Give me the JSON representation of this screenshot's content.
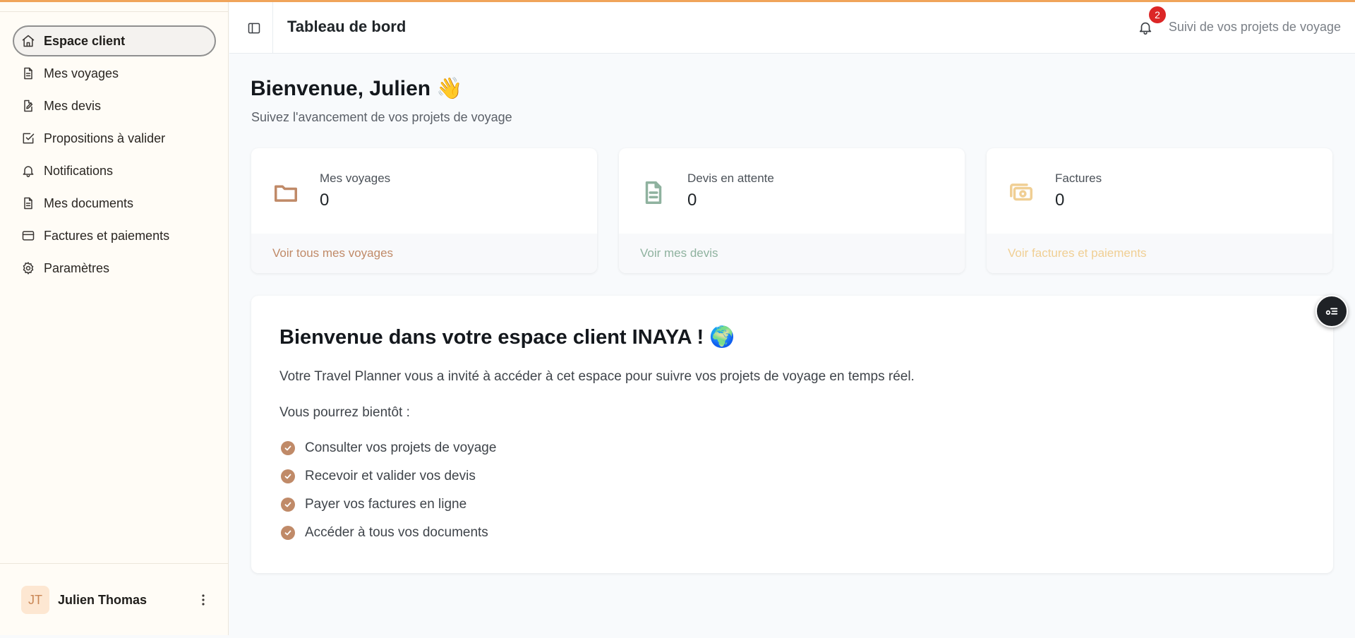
{
  "sidebar": {
    "items": [
      {
        "label": "Espace client",
        "icon": "home-icon",
        "active": true
      },
      {
        "label": "Mes voyages",
        "icon": "document-icon"
      },
      {
        "label": "Mes devis",
        "icon": "edit-document-icon"
      },
      {
        "label": "Propositions à valider",
        "icon": "check-square-icon"
      },
      {
        "label": "Notifications",
        "icon": "bell-icon"
      },
      {
        "label": "Mes documents",
        "icon": "document-icon"
      },
      {
        "label": "Factures et paiements",
        "icon": "credit-card-icon"
      },
      {
        "label": "Paramètres",
        "icon": "gear-icon"
      }
    ],
    "user": {
      "initials": "JT",
      "name": "Julien Thomas"
    }
  },
  "header": {
    "title": "Tableau de bord",
    "notification_count": "2",
    "subtitle": "Suivi de vos projets de voyage"
  },
  "main": {
    "welcome_title": "Bienvenue, Julien 👋",
    "welcome_sub": "Suivez l'avancement de vos projets de voyage",
    "stats": [
      {
        "label": "Mes voyages",
        "value": "0",
        "link": "Voir tous mes voyages",
        "color": "#c08a68",
        "icon": "folder-icon"
      },
      {
        "label": "Devis en attente",
        "value": "0",
        "link": "Voir mes devis",
        "color": "#8fb29f",
        "icon": "document-icon"
      },
      {
        "label": "Factures",
        "value": "0",
        "link": "Voir factures et paiements",
        "color": "#f0cf94",
        "icon": "money-icon"
      }
    ],
    "info": {
      "title": "Bienvenue dans votre espace client INAYA ! 🌍",
      "text": "Votre Travel Planner vous a invité à accéder à cet espace pour suivre vos projets de voyage en temps réel.",
      "text2": "Vous pourrez bientôt :",
      "features": [
        "Consulter vos projets de voyage",
        "Recevoir et valider vos devis",
        "Payer vos factures en ligne",
        "Accéder à tous vos documents"
      ]
    }
  },
  "colors": {
    "accent": "#f0a45a",
    "badge": "#dc2626",
    "check": "#c08a68"
  }
}
